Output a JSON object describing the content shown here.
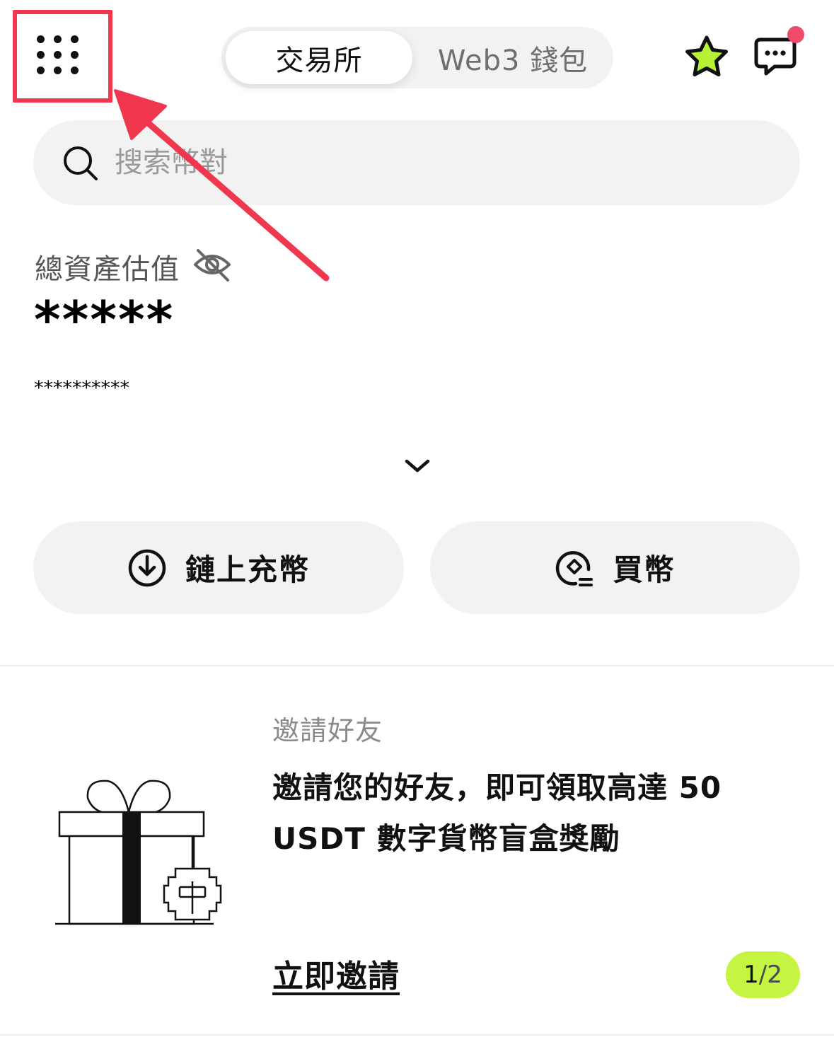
{
  "header": {
    "tabs": [
      {
        "label": "交易所",
        "active": true
      },
      {
        "label": "Web3 錢包",
        "active": false
      }
    ],
    "icons": [
      "menu-grid-icon",
      "star-icon",
      "chat-icon"
    ],
    "star_color": "#b8f236",
    "notification_dot_color": "#ef4a68"
  },
  "search": {
    "placeholder": "搜索幣對"
  },
  "assets": {
    "label": "總資產估值",
    "value_masked": "*****",
    "sub_masked": "**********"
  },
  "actions": {
    "deposit_label": "鏈上充幣",
    "buy_label": "買幣"
  },
  "invite": {
    "eyebrow": "邀請好友",
    "title": "邀請您的好友，即可領取高達 50 USDT 數字貨幣盲盒獎勵",
    "cta": "立即邀請",
    "pager": {
      "current": "1",
      "separator": "/",
      "total": "2"
    }
  },
  "colors": {
    "accent": "#c5f542",
    "annotation": "#f0374e",
    "surface": "#f2f2f2"
  }
}
